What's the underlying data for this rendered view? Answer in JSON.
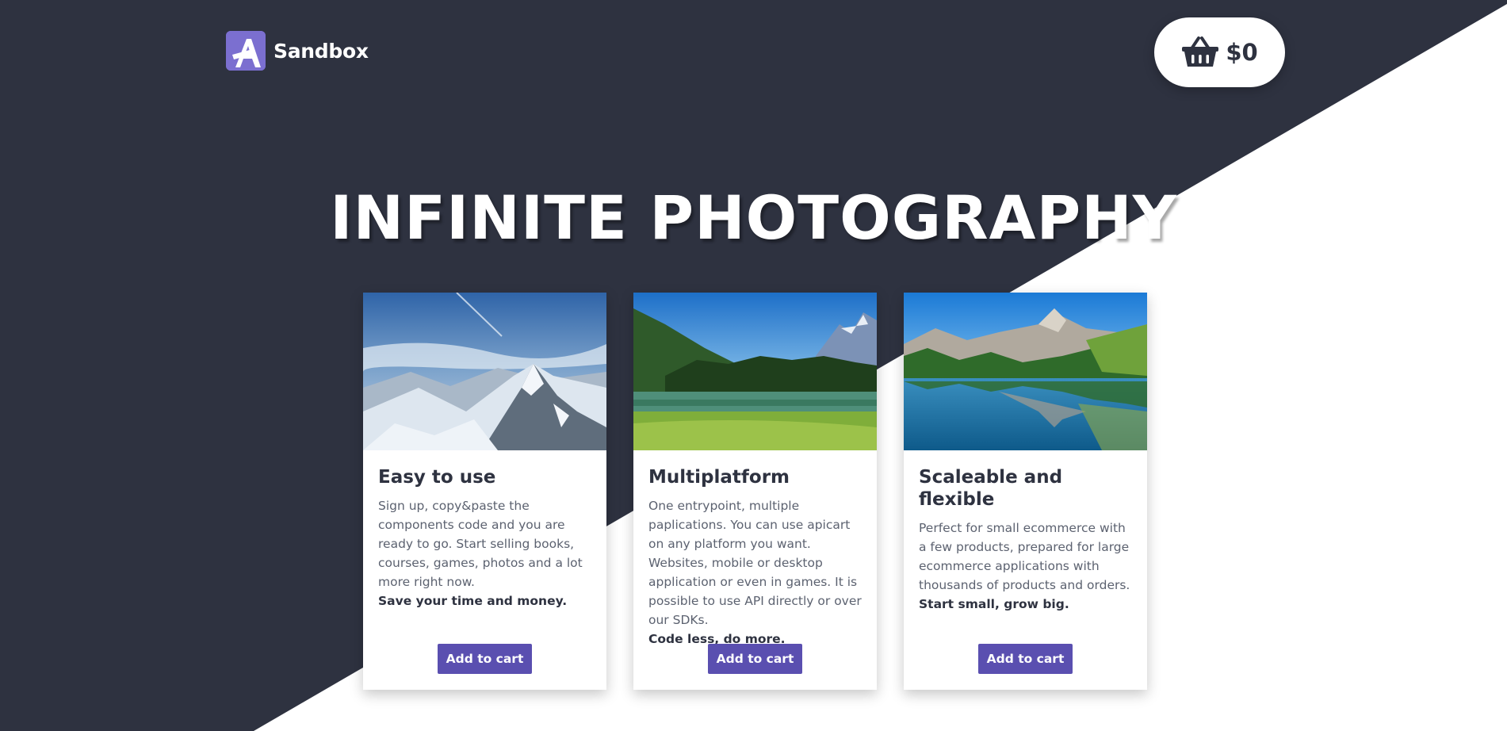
{
  "brand": {
    "name": "Sandbox",
    "logo_icon": "apicart-logo-icon",
    "accent": "#7b6fd0"
  },
  "cart": {
    "icon": "basket-icon",
    "total": "$0"
  },
  "hero": {
    "title": "INFINITE PHOTOGRAPHY"
  },
  "colors": {
    "dark_background": "#2e3240",
    "button": "#5a4fb0",
    "white": "#ffffff"
  },
  "products": [
    {
      "image": "snowy-mountain-range-photo",
      "title": "Easy to use",
      "description": "Sign up, copy&paste the components code and you are ready to go. Start selling books, courses, games, photos and a lot more right now.",
      "highlight": "Save your time and money.",
      "button": "Add to cart"
    },
    {
      "image": "forest-lake-meadow-photo",
      "title": "Multiplatform",
      "description": "One entrypoint, multiple paplications. You can use apicart on any platform you want. Websites, mobile or desktop application or even in games. It is possible to use API directly or over our SDKs.",
      "highlight": "Code less, do more.",
      "button": "Add to cart"
    },
    {
      "image": "mountain-lake-reflection-photo",
      "title": "Scaleable and flexible",
      "description": "Perfect for small ecommerce with a few products, prepared for large ecommerce applications with thousands of products and orders.",
      "highlight": "Start small, grow big.",
      "button": "Add to cart"
    }
  ]
}
